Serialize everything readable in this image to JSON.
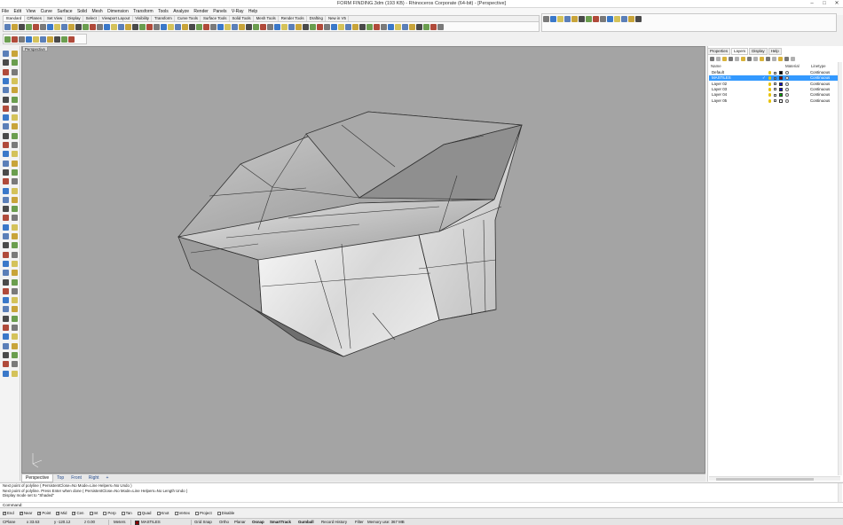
{
  "window": {
    "title": "FORM FINDING.3dm (193 KB) - Rhinoceros Corporate (64-bit) - [Perspective]",
    "minimize": "–",
    "maximize": "□",
    "close": "✕"
  },
  "menu": [
    "File",
    "Edit",
    "View",
    "Curve",
    "Surface",
    "Solid",
    "Mesh",
    "Dimension",
    "Transform",
    "Tools",
    "Analyze",
    "Render",
    "Panels",
    "V-Ray",
    "Help"
  ],
  "toolbar_tabs": [
    "Standard",
    "CPlanes",
    "Set View",
    "Display",
    "Select",
    "Viewport Layout",
    "Visibility",
    "Transform",
    "Curve Tools",
    "Surface Tools",
    "Solid Tools",
    "Mesh Tools",
    "Render Tools",
    "Drafting",
    "New in V5"
  ],
  "active_toolbar_tab": "Standard",
  "viewport": {
    "label": "Perspective",
    "display_mode": "Shaded",
    "background": "#a4a4a4"
  },
  "viewport_tabs": [
    "Perspective",
    "Top",
    "Front",
    "Right",
    "+"
  ],
  "active_viewport_tab": "Perspective",
  "panel": {
    "tabs": [
      "Properties",
      "Layers",
      "Display",
      "Help"
    ],
    "active_tab": "Layers",
    "columns": {
      "name": "Name",
      "material": "Material",
      "linetype": "Linetype"
    },
    "layers": [
      {
        "name": "Default",
        "linetype": "Continuous",
        "color": "#000000",
        "selected": false,
        "current": false
      },
      {
        "name": "MASTILES",
        "linetype": "Continuous",
        "color": "#8b0000",
        "selected": true,
        "current": true
      },
      {
        "name": "Layer 02",
        "linetype": "Continuous",
        "color": "#1010cc",
        "selected": false,
        "current": false
      },
      {
        "name": "Layer 03",
        "linetype": "Continuous",
        "color": "#1010cc",
        "selected": false,
        "current": false
      },
      {
        "name": "Layer 04",
        "linetype": "Continuous",
        "color": "#00aa00",
        "selected": false,
        "current": false
      },
      {
        "name": "Layer 05",
        "linetype": "Continuous",
        "color": "#ffffff",
        "selected": false,
        "current": false
      }
    ]
  },
  "command_history": [
    "Next point of polyline ( PersistentClose=No  Mode=Line  Helpers=No  Undo )",
    "Next point of polyline. Press Enter when done ( PersistentClose=No  Mode=Line  Helpers=No  Length  Undo )",
    "Display mode set to \"Shaded\""
  ],
  "command_prompt": "Command:",
  "osnaps": [
    {
      "label": "End",
      "checked": true
    },
    {
      "label": "Near",
      "checked": true
    },
    {
      "label": "Point",
      "checked": true
    },
    {
      "label": "Mid",
      "checked": true
    },
    {
      "label": "Cen",
      "checked": true
    },
    {
      "label": "Int",
      "checked": false
    },
    {
      "label": "Perp",
      "checked": false
    },
    {
      "label": "Tan",
      "checked": false
    },
    {
      "label": "Quad",
      "checked": false
    },
    {
      "label": "Knot",
      "checked": false
    },
    {
      "label": "Vertex",
      "checked": false
    },
    {
      "label": "Project",
      "checked": false
    },
    {
      "label": "Disable",
      "checked": false
    }
  ],
  "status": {
    "cplane": "CPlane",
    "x": "x 33.63",
    "y": "y -120.12",
    "z": "z 0.00",
    "units": "Meters",
    "layer": "MASTILES",
    "layer_color": "#8b0000",
    "grid_snap": "Grid Snap",
    "ortho": "Ortho",
    "planar": "Planar",
    "osnap": "Osnap",
    "smarttrack": "SmartTrack",
    "gumball": "Gumball",
    "record_history": "Record History",
    "filter": "Filter",
    "memory": "Memory use: 367 MB"
  },
  "toolbar_icon_colors": [
    "#5b7fb8",
    "#c8a43a",
    "#4a4a4a",
    "#6b9e4f",
    "#b04a3a",
    "#7a7a7a",
    "#3a78c9",
    "#d4c25a"
  ]
}
